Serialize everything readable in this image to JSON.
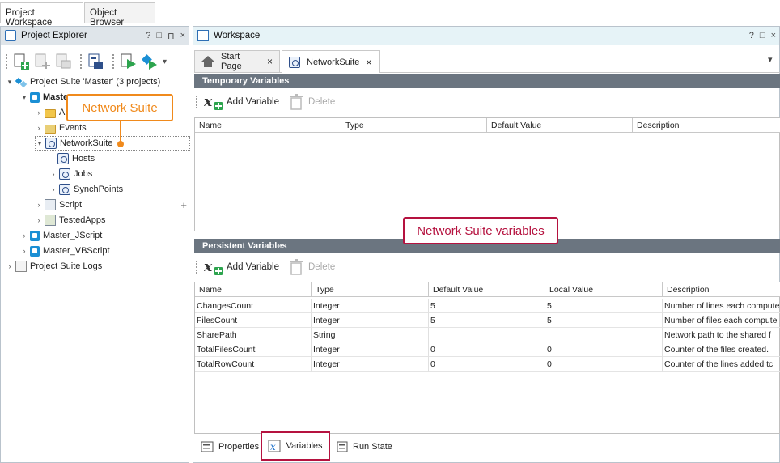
{
  "top_tabs": [
    "Project Workspace",
    "Object Browser"
  ],
  "explorer": {
    "title": "Project Explorer",
    "controls": [
      "?",
      "□",
      "⊓",
      "×"
    ],
    "tree": [
      {
        "label": "Project Suite 'Master' (3 projects)"
      },
      {
        "label": "Master",
        "bold": true
      },
      {
        "label": "A"
      },
      {
        "label": "Events"
      },
      {
        "label": "NetworkSuite"
      },
      {
        "label": "Hosts"
      },
      {
        "label": "Jobs"
      },
      {
        "label": "SynchPoints"
      },
      {
        "label": "Script"
      },
      {
        "label": "TestedApps"
      },
      {
        "label": "Master_JScript"
      },
      {
        "label": "Master_VBScript"
      },
      {
        "label": "Project Suite Logs"
      }
    ]
  },
  "workspace": {
    "title": "Workspace",
    "controls": [
      "?",
      "□",
      "×"
    ],
    "tabs": [
      {
        "label": "Start Page",
        "close": "×"
      },
      {
        "label": "NetworkSuite",
        "close": "×"
      }
    ],
    "dropdown": "▾"
  },
  "temp_vars": {
    "title": "Temporary Variables",
    "add_label": "Add Variable",
    "delete_label": "Delete",
    "columns": [
      "Name",
      "Type",
      "Default Value",
      "Description"
    ]
  },
  "persist_vars": {
    "title": "Persistent Variables",
    "add_label": "Add Variable",
    "delete_label": "Delete",
    "columns": [
      "Name",
      "Type",
      "Default Value",
      "Local Value",
      "Description"
    ],
    "rows": [
      [
        "ChangesCount",
        "Integer",
        "5",
        "5",
        "Number of lines each compute"
      ],
      [
        "FilesCount",
        "Integer",
        "5",
        "5",
        "Number of files each compute"
      ],
      [
        "SharePath",
        "String",
        "",
        "",
        "Network path to the shared f"
      ],
      [
        "TotalFilesCount",
        "Integer",
        "0",
        "0",
        "Counter of the files created."
      ],
      [
        "TotalRowCount",
        "Integer",
        "0",
        "0",
        "Counter of the lines added tc"
      ]
    ]
  },
  "bottom_tabs": [
    "Properties",
    "Variables",
    "Run State"
  ],
  "callouts": {
    "network_suite": "Network Suite",
    "variables": "Network Suite variables"
  },
  "colors": {
    "orange": "#f08a1c",
    "crimson": "#b5123f",
    "section": "#6b7580"
  },
  "misc": {
    "plus": "+"
  }
}
